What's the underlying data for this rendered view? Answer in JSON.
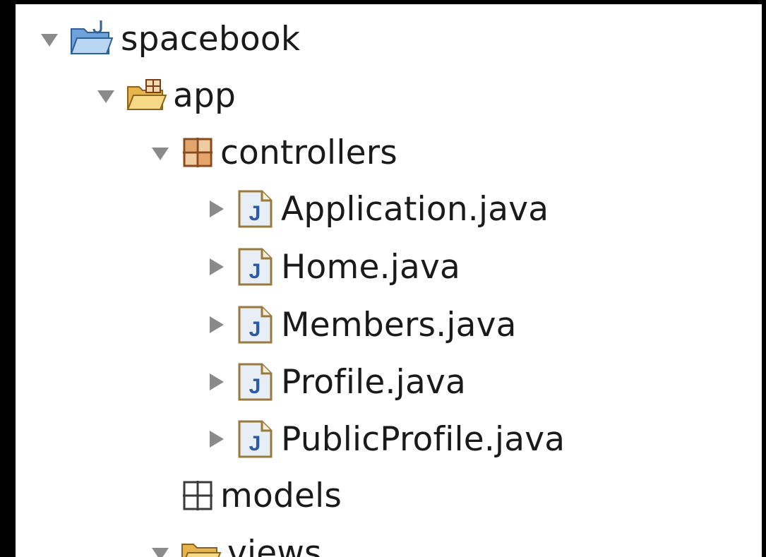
{
  "explorer": {
    "items": [
      {
        "label": "spacebook",
        "icon": "java-project-folder-icon",
        "expanded": true,
        "depth": 0
      },
      {
        "label": "app",
        "icon": "source-folder-icon",
        "expanded": true,
        "depth": 1
      },
      {
        "label": "controllers",
        "icon": "package-icon",
        "expanded": true,
        "depth": 2
      },
      {
        "label": "Application.java",
        "icon": "java-file-icon",
        "expanded": false,
        "depth": 3
      },
      {
        "label": "Home.java",
        "icon": "java-file-icon",
        "expanded": false,
        "depth": 3
      },
      {
        "label": "Members.java",
        "icon": "java-file-icon",
        "expanded": false,
        "depth": 3
      },
      {
        "label": "Profile.java",
        "icon": "java-file-icon",
        "expanded": false,
        "depth": 3
      },
      {
        "label": "PublicProfile.java",
        "icon": "java-file-icon",
        "expanded": false,
        "depth": 3
      },
      {
        "label": "models",
        "icon": "empty-package-icon",
        "expanded": null,
        "depth": 2
      },
      {
        "label": "views",
        "icon": "folder-icon",
        "expanded": true,
        "depth": 2
      }
    ]
  },
  "colors": {
    "disclosure": "#8a8a8a",
    "folder": "#f3cf6b",
    "package": "#b5723a",
    "java_file_border": "#9a7a3c",
    "java_letter": "#2b5aa6"
  }
}
